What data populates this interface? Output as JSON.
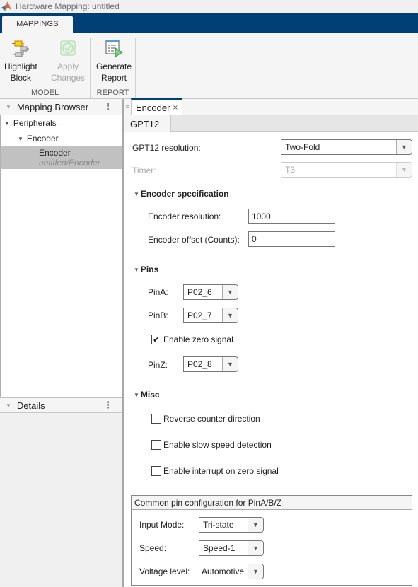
{
  "window": {
    "title": "Hardware Mapping: untitled"
  },
  "ribbon": {
    "tab": "MAPPINGS",
    "buttons": {
      "highlight": [
        "Highlight",
        "Block"
      ],
      "apply": [
        "Apply",
        "Changes"
      ],
      "generate": [
        "Generate",
        "Report"
      ]
    },
    "sections": {
      "model": "MODEL",
      "report": "REPORT"
    }
  },
  "left": {
    "browser_title": "Mapping Browser",
    "menu_glyph": "⋮",
    "tree": {
      "root": "Peripherals",
      "child": "Encoder",
      "selected_name": "Encoder",
      "selected_path": "untitled/Encoder"
    },
    "details_title": "Details"
  },
  "doc": {
    "tab": "Encoder",
    "close_glyph": "×",
    "subtab": "GPT12",
    "resolution": {
      "label": "GPT12 resolution:",
      "value": "Two-Fold"
    },
    "timer": {
      "label": "Timer:",
      "value": "T3"
    },
    "encoder_spec": {
      "title": "Encoder specification",
      "resolution_label": "Encoder resolution:",
      "resolution_value": "1000",
      "offset_label": "Encoder offset (Counts):",
      "offset_value": "0"
    },
    "pins": {
      "title": "Pins",
      "pinA_label": "PinA:",
      "pinA_value": "P02_6",
      "pinB_label": "PinB:",
      "pinB_value": "P02_7",
      "zero_label": "Enable zero signal",
      "zero_checked": true,
      "pinZ_label": "PinZ:",
      "pinZ_value": "P02_8"
    },
    "misc": {
      "title": "Misc",
      "reverse": "Reverse counter direction",
      "slow": "Enable slow speed detection",
      "interrupt": "Enable interrupt on zero signal"
    },
    "common": {
      "title": "Common pin configuration for PinA/B/Z",
      "input_label": "Input Mode:",
      "input_value": "Tri-state",
      "speed_label": "Speed:",
      "speed_value": "Speed-1",
      "voltage_label": "Voltage level:",
      "voltage_value": "Automotive"
    }
  },
  "glyphs": {
    "caret_down": "▼",
    "check": "✔"
  }
}
